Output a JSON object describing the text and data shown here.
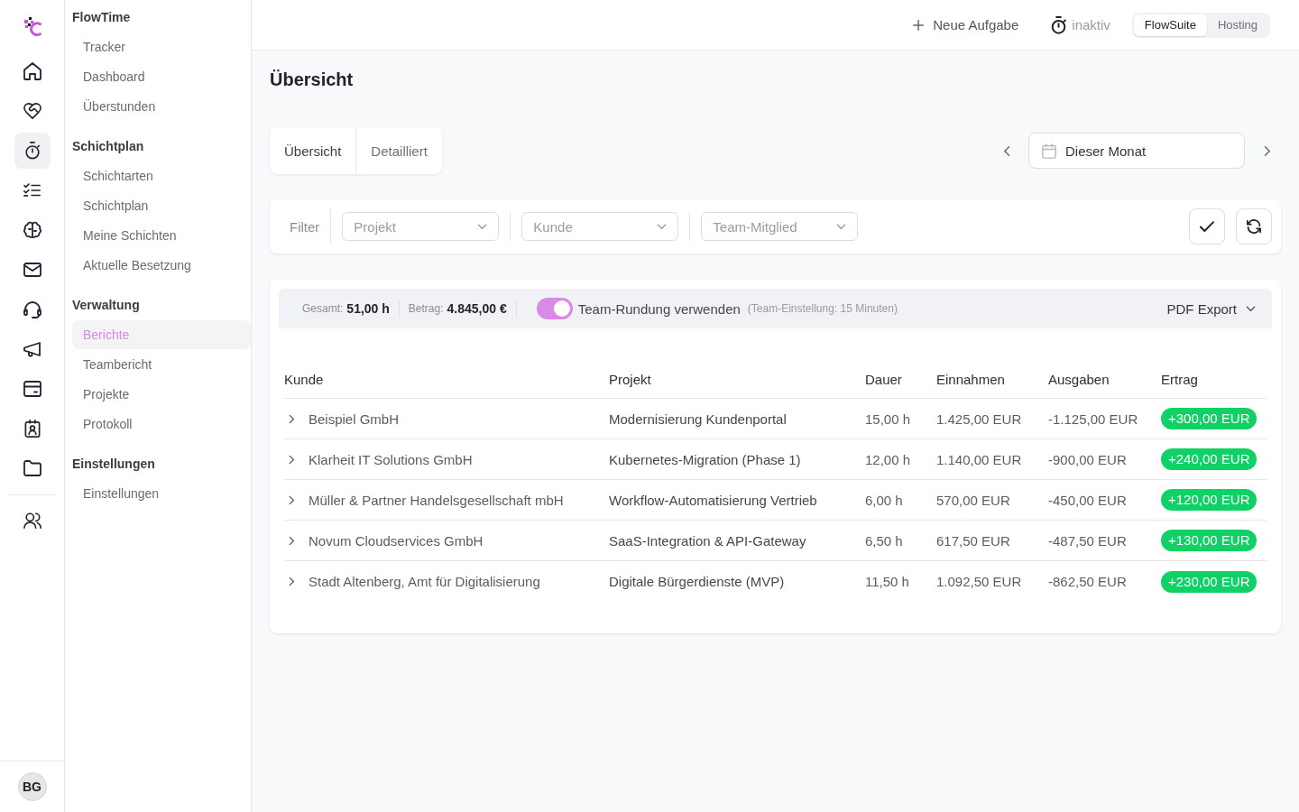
{
  "rail": {
    "items": [
      {
        "selected": false
      },
      {
        "selected": false
      },
      {
        "selected": true
      },
      {
        "selected": false
      },
      {
        "selected": false
      },
      {
        "selected": false
      },
      {
        "selected": false
      },
      {
        "selected": false
      },
      {
        "selected": false
      },
      {
        "selected": false
      },
      {
        "selected": false
      }
    ],
    "extra_items": [
      {
        "selected": false
      }
    ],
    "avatar": {
      "initials": "BG"
    }
  },
  "sidebar": {
    "sections": [
      {
        "title": "FlowTime",
        "items": [
          {
            "label": "Tracker",
            "selected": false
          },
          {
            "label": "Dashboard",
            "selected": false
          },
          {
            "label": "Überstunden",
            "selected": false
          }
        ]
      },
      {
        "title": "Schichtplan",
        "items": [
          {
            "label": "Schichtarten",
            "selected": false
          },
          {
            "label": "Schichtplan",
            "selected": false
          },
          {
            "label": "Meine Schichten",
            "selected": false
          },
          {
            "label": "Aktuelle Besetzung",
            "selected": false
          }
        ]
      },
      {
        "title": "Verwaltung",
        "items": [
          {
            "label": "Berichte",
            "selected": true
          },
          {
            "label": "Teambericht",
            "selected": false
          },
          {
            "label": "Projekte",
            "selected": false
          },
          {
            "label": "Protokoll",
            "selected": false
          }
        ]
      },
      {
        "title": "Einstellungen",
        "items": [
          {
            "label": "Einstellungen",
            "selected": false
          }
        ]
      }
    ]
  },
  "topbar": {
    "new_task": "Neue Aufgabe",
    "timer_status": "inaktiv",
    "workspaces": [
      {
        "label": "FlowSuite",
        "selected": true
      },
      {
        "label": "Hosting",
        "selected": false
      }
    ]
  },
  "page_title": "Übersicht",
  "view_tabs": [
    {
      "label": "Übersicht",
      "selected": true
    },
    {
      "label": "Detailliert",
      "selected": false
    }
  ],
  "date_range": {
    "value": "Dieser Monat"
  },
  "filter": {
    "label": "Filter",
    "selects": [
      {
        "placeholder": "Projekt"
      },
      {
        "placeholder": "Kunde"
      },
      {
        "placeholder": "Team-Mitglied"
      }
    ]
  },
  "summary": {
    "total_label": "Gesamt:",
    "total": "51,00 h",
    "amount_label": "Betrag:",
    "amount": "4.845,00 €",
    "rounding": {
      "on": true,
      "label": "Team-Rundung verwenden",
      "note": "(Team-Einstellung: 15 Minuten)"
    },
    "export": "PDF Export"
  },
  "table": {
    "columns": [
      "Kunde",
      "Projekt",
      "Dauer",
      "Einnahmen",
      "Ausgaben",
      "Ertrag"
    ],
    "rows": [
      {
        "expanded": false,
        "customer": "Beispiel GmbH",
        "project": "Modernisierung Kundenportal",
        "duration": "15,00 h",
        "income": "1.425,00 EUR",
        "expenses": "-1.125,00 EUR",
        "profit": "+300,00 EUR"
      },
      {
        "expanded": false,
        "customer": "Klarheit IT Solutions GmbH",
        "project": "Kubernetes-Migration (Phase 1)",
        "duration": "12,00 h",
        "income": "1.140,00 EUR",
        "expenses": "-900,00 EUR",
        "profit": "+240,00 EUR"
      },
      {
        "expanded": false,
        "customer": "Müller & Partner Handelsgesellschaft mbH",
        "project": "Workflow-Automatisierung Vertrieb",
        "duration": "6,00 h",
        "income": "570,00 EUR",
        "expenses": "-450,00 EUR",
        "profit": "+120,00 EUR"
      },
      {
        "expanded": false,
        "customer": "Novum Cloudservices GmbH",
        "project": "SaaS-Integration & API-Gateway",
        "duration": "6,50 h",
        "income": "617,50 EUR",
        "expenses": "-487,50 EUR",
        "profit": "+130,00 EUR"
      },
      {
        "expanded": false,
        "customer": "Stadt Altenberg, Amt für Digitalisierung",
        "project": "Digitale Bürgerdienste (MVP)",
        "duration": "11,50 h",
        "income": "1.092,50 EUR",
        "expenses": "-862,50 EUR",
        "profit": "+230,00 EUR"
      }
    ]
  }
}
